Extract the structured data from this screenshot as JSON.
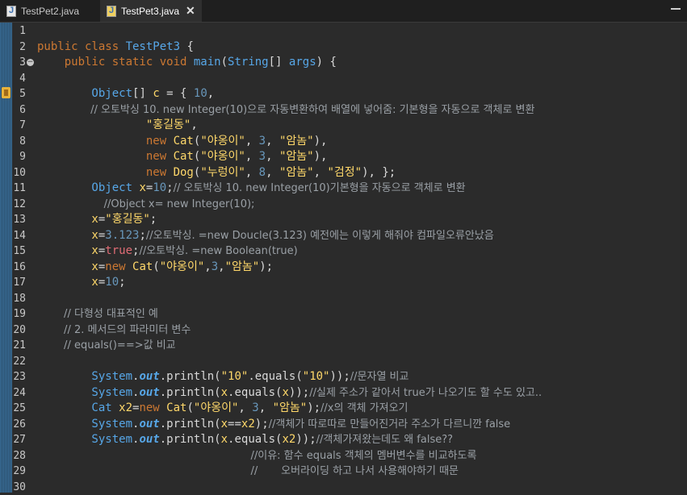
{
  "tabs": [
    {
      "label": "TestPet2.java",
      "active": false
    },
    {
      "label": "TestPet3.java",
      "active": true
    }
  ],
  "lines": [
    {
      "n": "1",
      "segs": []
    },
    {
      "n": "2",
      "segs": [
        [
          "kw",
          "public class "
        ],
        [
          "type",
          "TestPet3 "
        ],
        [
          "plain",
          "{"
        ]
      ]
    },
    {
      "n": "3",
      "fold": true,
      "segs": [
        [
          "kw",
          "    public static void "
        ],
        [
          "type",
          "main"
        ],
        [
          "plain",
          "("
        ],
        [
          "type",
          "String"
        ],
        [
          "plain",
          "[] "
        ],
        [
          "type",
          "args"
        ],
        [
          "plain",
          ") {"
        ]
      ]
    },
    {
      "n": "4",
      "segs": []
    },
    {
      "n": "5",
      "segs": [
        [
          "type",
          "        Object"
        ],
        [
          "plain",
          "[] "
        ],
        [
          "var",
          "c"
        ],
        [
          "plain",
          " = { "
        ],
        [
          "num",
          "10"
        ],
        [
          "plain",
          ","
        ]
      ]
    },
    {
      "n": "6",
      "segs": [
        [
          "cmt",
          "                // 오토박싱 10. new Integer(10)으로 자동변환하여 배열에 넣어줌: 기본형을 자동으로 객체로 변환"
        ]
      ]
    },
    {
      "n": "7",
      "segs": [
        [
          "str",
          "                \"홍길동\""
        ],
        [
          "plain",
          ","
        ]
      ]
    },
    {
      "n": "8",
      "segs": [
        [
          "kw",
          "                new "
        ],
        [
          "cls",
          "Cat"
        ],
        [
          "plain",
          "("
        ],
        [
          "str",
          "\"야옹이\""
        ],
        [
          "plain",
          ", "
        ],
        [
          "num",
          "3"
        ],
        [
          "plain",
          ", "
        ],
        [
          "str",
          "\"암놈\""
        ],
        [
          "plain",
          "),"
        ]
      ]
    },
    {
      "n": "9",
      "segs": [
        [
          "kw",
          "                new "
        ],
        [
          "cls",
          "Cat"
        ],
        [
          "plain",
          "("
        ],
        [
          "str",
          "\"야옹이\""
        ],
        [
          "plain",
          ", "
        ],
        [
          "num",
          "3"
        ],
        [
          "plain",
          ", "
        ],
        [
          "str",
          "\"암놈\""
        ],
        [
          "plain",
          "),"
        ]
      ]
    },
    {
      "n": "10",
      "segs": [
        [
          "kw",
          "                new "
        ],
        [
          "cls",
          "Dog"
        ],
        [
          "plain",
          "("
        ],
        [
          "str",
          "\"누렁이\""
        ],
        [
          "plain",
          ", "
        ],
        [
          "num",
          "8"
        ],
        [
          "plain",
          ", "
        ],
        [
          "str",
          "\"암놈\""
        ],
        [
          "plain",
          ", "
        ],
        [
          "str",
          "\"검정\""
        ],
        [
          "plain",
          "), };"
        ]
      ]
    },
    {
      "n": "11",
      "segs": [
        [
          "type",
          "        Object "
        ],
        [
          "var",
          "x"
        ],
        [
          "plain",
          "="
        ],
        [
          "num",
          "10"
        ],
        [
          "plain",
          ";"
        ],
        [
          "cmt",
          "// 오토박싱 10. new Integer(10)기본형을 자동으로 객체로 변환"
        ]
      ]
    },
    {
      "n": "12",
      "segs": [
        [
          "cmt",
          "                    //Object x= new Integer(10);"
        ]
      ]
    },
    {
      "n": "13",
      "segs": [
        [
          "var",
          "        x"
        ],
        [
          "plain",
          "="
        ],
        [
          "str",
          "\"홍길동\""
        ],
        [
          "plain",
          ";"
        ]
      ]
    },
    {
      "n": "14",
      "segs": [
        [
          "var",
          "        x"
        ],
        [
          "plain",
          "="
        ],
        [
          "num",
          "3.123"
        ],
        [
          "plain",
          ";"
        ],
        [
          "cmt",
          "//오토박싱. =new Doucle(3.123) 예전에는 이렇게 해줘야 컴파일오류안났음"
        ]
      ]
    },
    {
      "n": "15",
      "segs": [
        [
          "var",
          "        x"
        ],
        [
          "plain",
          "="
        ],
        [
          "kw2",
          "true"
        ],
        [
          "plain",
          ";"
        ],
        [
          "cmt",
          "//오토박싱. =new Boolean(true)"
        ]
      ]
    },
    {
      "n": "16",
      "segs": [
        [
          "var",
          "        x"
        ],
        [
          "plain",
          "="
        ],
        [
          "kw",
          "new "
        ],
        [
          "cls",
          "Cat"
        ],
        [
          "plain",
          "("
        ],
        [
          "str",
          "\"야옹이\""
        ],
        [
          "plain",
          ","
        ],
        [
          "num",
          "3"
        ],
        [
          "plain",
          ","
        ],
        [
          "str",
          "\"암놈\""
        ],
        [
          "plain",
          ");"
        ]
      ]
    },
    {
      "n": "17",
      "segs": [
        [
          "var",
          "        x"
        ],
        [
          "plain",
          "="
        ],
        [
          "num",
          "10"
        ],
        [
          "plain",
          ";"
        ]
      ]
    },
    {
      "n": "18",
      "segs": []
    },
    {
      "n": "19",
      "segs": [
        [
          "cmt",
          "        // 다형성 대표적인 예"
        ]
      ]
    },
    {
      "n": "20",
      "segs": [
        [
          "cmt",
          "        // 2. 메서드의 파라미터 변수"
        ]
      ]
    },
    {
      "n": "21",
      "segs": [
        [
          "cmt",
          "        // equals()==>값 비교"
        ]
      ]
    },
    {
      "n": "22",
      "segs": []
    },
    {
      "n": "23",
      "segs": [
        [
          "type",
          "        System"
        ],
        [
          "plain",
          "."
        ],
        [
          "fld",
          "out"
        ],
        [
          "plain",
          ".println("
        ],
        [
          "str",
          "\"10\""
        ],
        [
          "plain",
          ".equals("
        ],
        [
          "str",
          "\"10\""
        ],
        [
          "plain",
          "));"
        ],
        [
          "cmt",
          "//문자열 비교"
        ]
      ]
    },
    {
      "n": "24",
      "segs": [
        [
          "type",
          "        System"
        ],
        [
          "plain",
          "."
        ],
        [
          "fld",
          "out"
        ],
        [
          "plain",
          ".println("
        ],
        [
          "var",
          "x"
        ],
        [
          "plain",
          ".equals("
        ],
        [
          "var",
          "x"
        ],
        [
          "plain",
          "));"
        ],
        [
          "cmt",
          "//실제 주소가 같아서 true가 나오기도 할 수도 있고.."
        ]
      ]
    },
    {
      "n": "25",
      "segs": [
        [
          "type",
          "        Cat "
        ],
        [
          "var",
          "x2"
        ],
        [
          "plain",
          "="
        ],
        [
          "kw",
          "new "
        ],
        [
          "cls",
          "Cat"
        ],
        [
          "plain",
          "("
        ],
        [
          "str",
          "\"야옹이\""
        ],
        [
          "plain",
          ", "
        ],
        [
          "num",
          "3"
        ],
        [
          "plain",
          ", "
        ],
        [
          "str",
          "\"암놈\""
        ],
        [
          "plain",
          ");"
        ],
        [
          "cmt",
          "//x의 객체 가져오기"
        ]
      ]
    },
    {
      "n": "26",
      "segs": [
        [
          "type",
          "        System"
        ],
        [
          "plain",
          "."
        ],
        [
          "fld",
          "out"
        ],
        [
          "plain",
          ".println("
        ],
        [
          "var",
          "x"
        ],
        [
          "plain",
          "=="
        ],
        [
          "var",
          "x2"
        ],
        [
          "plain",
          ");"
        ],
        [
          "cmt",
          "//객체가 따로따로 만들어진거라 주소가 다르니깐 false"
        ]
      ]
    },
    {
      "n": "27",
      "segs": [
        [
          "type",
          "        System"
        ],
        [
          "plain",
          "."
        ],
        [
          "fld",
          "out"
        ],
        [
          "plain",
          ".println("
        ],
        [
          "var",
          "x"
        ],
        [
          "plain",
          ".equals("
        ],
        [
          "var",
          "x2"
        ],
        [
          "plain",
          "));"
        ],
        [
          "cmt",
          "//객체가져왔는데도 왜 false??"
        ]
      ]
    },
    {
      "n": "28",
      "segs": [
        [
          "cmt",
          "                                                                //이유: 함수 equals 객체의 멤버변수를 비교하도록"
        ]
      ]
    },
    {
      "n": "29",
      "segs": [
        [
          "cmt",
          "                                                                //       오버라이딩 하고 나서 사용해야하기 때문"
        ]
      ]
    },
    {
      "n": "30",
      "segs": []
    }
  ]
}
